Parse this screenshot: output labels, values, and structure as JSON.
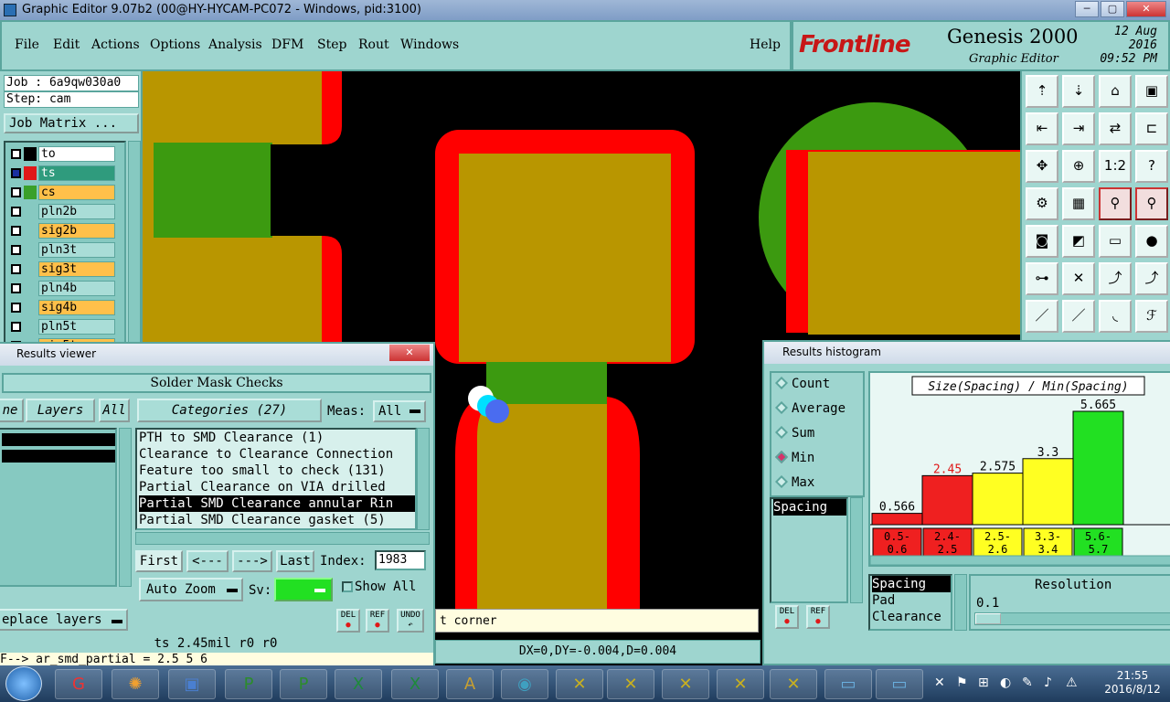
{
  "window": {
    "title": "Graphic Editor 9.07b2 (00@HY-HYCAM-PC072 - Windows, pid:3100)",
    "minimize": "─",
    "restore": "▢",
    "close": "✕"
  },
  "menu": {
    "file": "File",
    "edit": "Edit",
    "actions": "Actions",
    "options": "Options",
    "analysis": "Analysis",
    "dfm": "DFM",
    "step": "Step",
    "rout": "Rout",
    "windows": "Windows",
    "help": "Help"
  },
  "brand": {
    "logo": "Frontline",
    "product": "Genesis 2000",
    "subtitle": "Graphic Editor",
    "date": "12 Aug 2016",
    "time": "09:52 PM"
  },
  "job": {
    "job_line": "Job : 6a9qw030a0",
    "step_line": "Step: cam",
    "matrix_button": "Job Matrix ..."
  },
  "layers": [
    {
      "name": "to",
      "color": "#ffffff",
      "box": "#000000"
    },
    {
      "name": "ts",
      "color": "#2f9b7d",
      "box": "#e01818",
      "selected": true
    },
    {
      "name": "cs",
      "color": "#ffc04a",
      "box": "#3aa02a"
    },
    {
      "name": "pln2b",
      "color": "#a9ddd7",
      "box": ""
    },
    {
      "name": "sig2b",
      "color": "#ffc04a",
      "box": ""
    },
    {
      "name": "pln3t",
      "color": "#a9ddd7",
      "box": ""
    },
    {
      "name": "sig3t",
      "color": "#ffc04a",
      "box": ""
    },
    {
      "name": "pln4b",
      "color": "#a9ddd7",
      "box": ""
    },
    {
      "name": "sig4b",
      "color": "#ffc04a",
      "box": ""
    },
    {
      "name": "pln5t",
      "color": "#a9ddd7",
      "box": ""
    },
    {
      "name": "sig5t",
      "color": "#ffc04a",
      "box": ""
    }
  ],
  "results_viewer": {
    "title": "Results viewer",
    "header": "Solder Mask Checks",
    "col_left": "ne",
    "layers_label": "Layers",
    "all_label": "All",
    "categories": "Categories (27)",
    "meas_label": "Meas:",
    "meas_value": "All",
    "items": [
      "PTH to SMD Clearance (1)",
      "Clearance to Clearance Connection",
      "Feature too small to check (131)",
      "Partial Clearance on VIA drilled",
      "Partial SMD Clearance annular Rin",
      "Partial SMD Clearance gasket (5)"
    ],
    "first": "First",
    "prev": "<---",
    "next": "--->",
    "last": "Last",
    "index_label": "Index:",
    "index_value": "1983",
    "auto_zoom": "Auto Zoom",
    "sv_label": "Sv:",
    "show_all": "Show All",
    "replace_layers": "eplace layers",
    "del": "DEL",
    "ref": "REF",
    "undo": "UNDO",
    "info": "ts 2.45mil  r0  r0",
    "formula": "F--> ar_smd_partial = 2.5 5 6"
  },
  "status": {
    "message": "t corner",
    "coords": "DX=0,DY=-0.004,D=0.004"
  },
  "histogram": {
    "title": "Results histogram",
    "modes": [
      "Count",
      "Average",
      "Sum",
      "Min",
      "Max"
    ],
    "selected_mode": "Min",
    "left_list": [
      "Spacing"
    ],
    "del": "DEL",
    "ref": "REF",
    "bottom_list": [
      "Spacing",
      "Pad",
      "Clearance"
    ],
    "resolution_label": "Resolution",
    "resolution_value": "0.1",
    "colors": {
      "red": "#ef2020",
      "yellow": "#ffff22",
      "green": "#22e022"
    }
  },
  "chart_data": {
    "type": "bar",
    "title": "Size(Spacing) / Min(Spacing)",
    "categories": [
      "0.5-\n0.6",
      "2.4-\n2.5",
      "2.5-\n2.6",
      "3.3-\n3.4",
      "5.6-\n5.7"
    ],
    "cat_top": [
      "0.5-",
      "2.4-",
      "2.5-",
      "3.3-",
      "5.6-"
    ],
    "cat_bottom": [
      "0.6",
      "2.5",
      "2.6",
      "3.4",
      "5.7"
    ],
    "values": [
      0.566,
      2.45,
      2.575,
      3.3,
      5.665
    ],
    "value_labels": [
      "0.566",
      "2.45",
      "2.575",
      "3.3",
      "5.665"
    ],
    "bar_colors": [
      "#ef2020",
      "#ef2020",
      "#ffff22",
      "#ffff22",
      "#22e022"
    ],
    "label_colors": [
      "#000000",
      "#e01818",
      "#000000",
      "#000000",
      "#000000"
    ],
    "ylim": [
      0,
      5.665
    ]
  },
  "taskbar": {
    "time": "21:55",
    "date": "2016/8/12"
  }
}
